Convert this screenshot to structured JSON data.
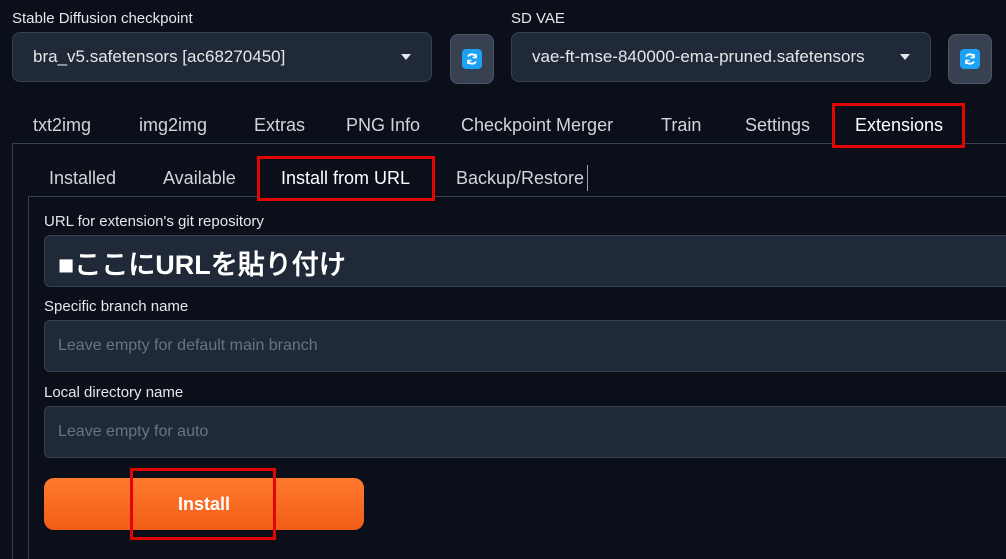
{
  "checkpoint": {
    "label": "Stable Diffusion checkpoint",
    "value": "bra_v5.safetensors [ac68270450]"
  },
  "vae": {
    "label": "SD VAE",
    "value": "vae-ft-mse-840000-ema-pruned.safetensors"
  },
  "tabs": [
    "txt2img",
    "img2img",
    "Extras",
    "PNG Info",
    "Checkpoint Merger",
    "Train",
    "Settings",
    "Extensions"
  ],
  "subtabs": [
    "Installed",
    "Available",
    "Install from URL",
    "Backup/Restore"
  ],
  "form": {
    "url_label": "URL for extension's git repository",
    "url_value": "■ここにURLを貼り付け",
    "branch_label": "Specific branch name",
    "branch_placeholder": "Leave empty for default main branch",
    "dir_label": "Local directory name",
    "dir_placeholder": "Leave empty for auto",
    "install_label": "Install"
  },
  "colors": {
    "accent": "#f15d17",
    "highlight": "#e10600",
    "refresh": "#1da1f2"
  },
  "icons": {
    "refresh": "refresh-icon",
    "dropdown": "chevron-down-icon"
  }
}
